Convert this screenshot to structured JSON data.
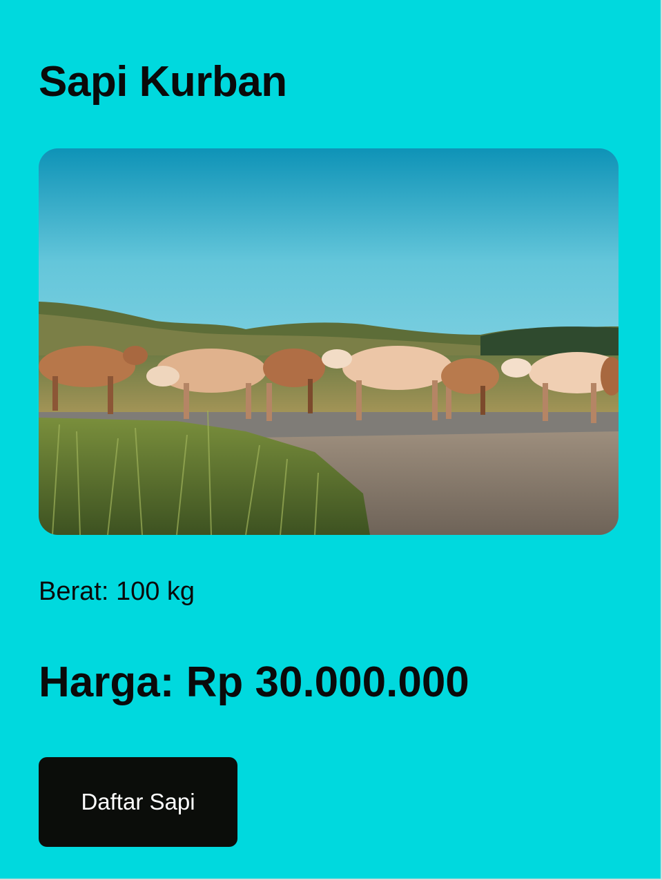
{
  "product": {
    "title": "Sapi Kurban",
    "image_description_icon": "cattle-photo",
    "weight_text": "Berat: 100 kg",
    "price_text": "Harga: Rp 30.000.000",
    "button_label": "Daftar Sapi"
  },
  "colors": {
    "background": "#00d9de",
    "button": "#0b0d0a",
    "button_text": "#ffffff",
    "text": "#0a0a0a"
  }
}
